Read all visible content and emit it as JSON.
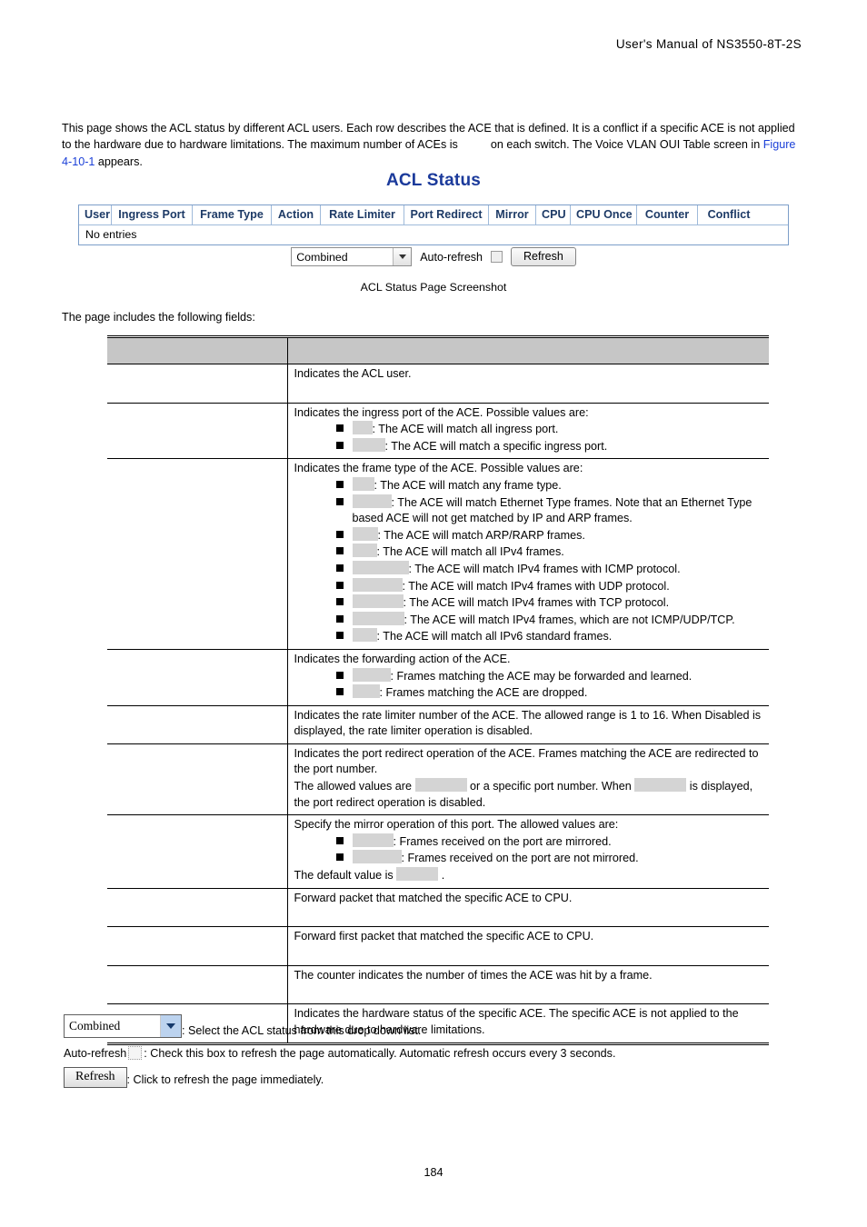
{
  "header": {
    "running_head": "User's  Manual  of  NS3550-8T-2S"
  },
  "intro": {
    "part1": "This page shows the ACL status by different ACL users. Each row describes the ACE that is defined. It is a conflict if a specific ACE is not applied to the hardware due to hardware limitations. The maximum number of ACEs is",
    "part2": "on each switch. The Voice VLAN OUI Table screen in",
    "figure_link": "Figure 4-10-1",
    "part3": "appears."
  },
  "screenshot": {
    "title": "ACL Status",
    "columns": [
      "User",
      "Ingress Port",
      "Frame Type",
      "Action",
      "Rate Limiter",
      "Port Redirect",
      "Mirror",
      "CPU",
      "CPU Once",
      "Counter",
      "Conflict"
    ],
    "empty_row": "No entries",
    "controls": {
      "select_value": "Combined",
      "autorefresh_label": "Auto-refresh",
      "refresh_label": "Refresh"
    },
    "caption": "ACL Status Page Screenshot"
  },
  "leadin": "The page includes the following fields:",
  "fields_table": {
    "headers": {
      "object": "",
      "description": ""
    },
    "rows": [
      {
        "object": "",
        "intro": "Indicates the ACL user.",
        "bullets": [],
        "outro": "",
        "tall": true
      },
      {
        "object": "",
        "intro": "Indicates the ingress port of the ACE. Possible values are:",
        "bullets": [
          {
            "term_width": 22,
            "text": ": The ACE will match all ingress port."
          },
          {
            "term_width": 36,
            "text": ": The ACE will match a specific ingress port."
          }
        ],
        "outro": ""
      },
      {
        "object": "",
        "intro": "Indicates the frame type of the ACE. Possible values are:",
        "bullets": [
          {
            "term_width": 24,
            "text": ": The ACE will match any frame type."
          },
          {
            "term_width": 43,
            "text": ": The ACE will match Ethernet Type frames. Note that an Ethernet Type based ACE will not get matched by IP and ARP frames."
          },
          {
            "term_width": 28,
            "text": ": The ACE will match ARP/RARP frames."
          },
          {
            "term_width": 27,
            "text": ": The ACE will match all IPv4 frames."
          },
          {
            "term_width": 62,
            "text": ": The ACE will match IPv4 frames with ICMP protocol."
          },
          {
            "term_width": 55,
            "text": ": The ACE will match IPv4 frames with UDP protocol."
          },
          {
            "term_width": 56,
            "text": ": The ACE will match IPv4 frames with TCP protocol."
          },
          {
            "term_width": 57,
            "text": ": The ACE will match IPv4 frames, which are not ICMP/UDP/TCP."
          },
          {
            "term_width": 27,
            "text": ": The ACE will match all IPv6 standard frames."
          }
        ],
        "outro": ""
      },
      {
        "object": "",
        "intro": "Indicates the forwarding action of the ACE.",
        "bullets": [
          {
            "term_width": 42,
            "text": ": Frames matching the ACE may be forwarded and learned."
          },
          {
            "term_width": 30,
            "text": ": Frames matching the ACE are dropped."
          }
        ],
        "outro": ""
      },
      {
        "object": "",
        "intro": "Indicates the rate limiter number of the ACE. The allowed range is 1 to 16. When Disabled is displayed, the rate limiter operation is disabled.",
        "bullets": [],
        "outro": ""
      },
      {
        "object": "",
        "intro": "Indicates the port redirect operation of the ACE. Frames matching the ACE are redirected to the port number.",
        "bullets": [],
        "outro_pre": "The allowed values are",
        "outro_mid": "or a specific port number. When",
        "outro_post": "is displayed, the port redirect operation is disabled.",
        "outro_ph1_width": 57,
        "outro_ph2_width": 57
      },
      {
        "object": "",
        "intro": "Specify the mirror operation of this port. The allowed values are:",
        "bullets": [
          {
            "term_width": 45,
            "text": ": Frames received on the port are mirrored."
          },
          {
            "term_width": 54,
            "text": ": Frames received on the port are not mirrored."
          }
        ],
        "outro_pre": "The default value is",
        "outro_ph1_width": 46,
        "outro_post": "."
      },
      {
        "object": "",
        "intro": "Forward packet that matched the specific ACE to CPU.",
        "bullets": [],
        "outro": "",
        "tall": true
      },
      {
        "object": "",
        "intro": "Forward first packet that matched the specific ACE to CPU.",
        "bullets": [],
        "outro": "",
        "tall": true
      },
      {
        "object": "",
        "intro": "The counter indicates the number of times the ACE was hit by a frame.",
        "bullets": [],
        "outro": "",
        "tall": true
      },
      {
        "object": "",
        "intro": "Indicates the hardware status of the specific ACE. The specific ACE is not applied to the hardware due to hardware limitations.",
        "bullets": [],
        "outro": ""
      }
    ]
  },
  "legend": {
    "select_value": "Combined",
    "select_desc": ": Select the ACL status from this drop down list.",
    "autorefresh_label": "Auto-refresh",
    "autorefresh_desc": ": Check this box to refresh the page automatically. Automatic refresh occurs every 3 seconds.",
    "refresh_label": "Refresh",
    "refresh_desc": ": Click to refresh the page immediately."
  },
  "footer": {
    "page_number": "184"
  }
}
